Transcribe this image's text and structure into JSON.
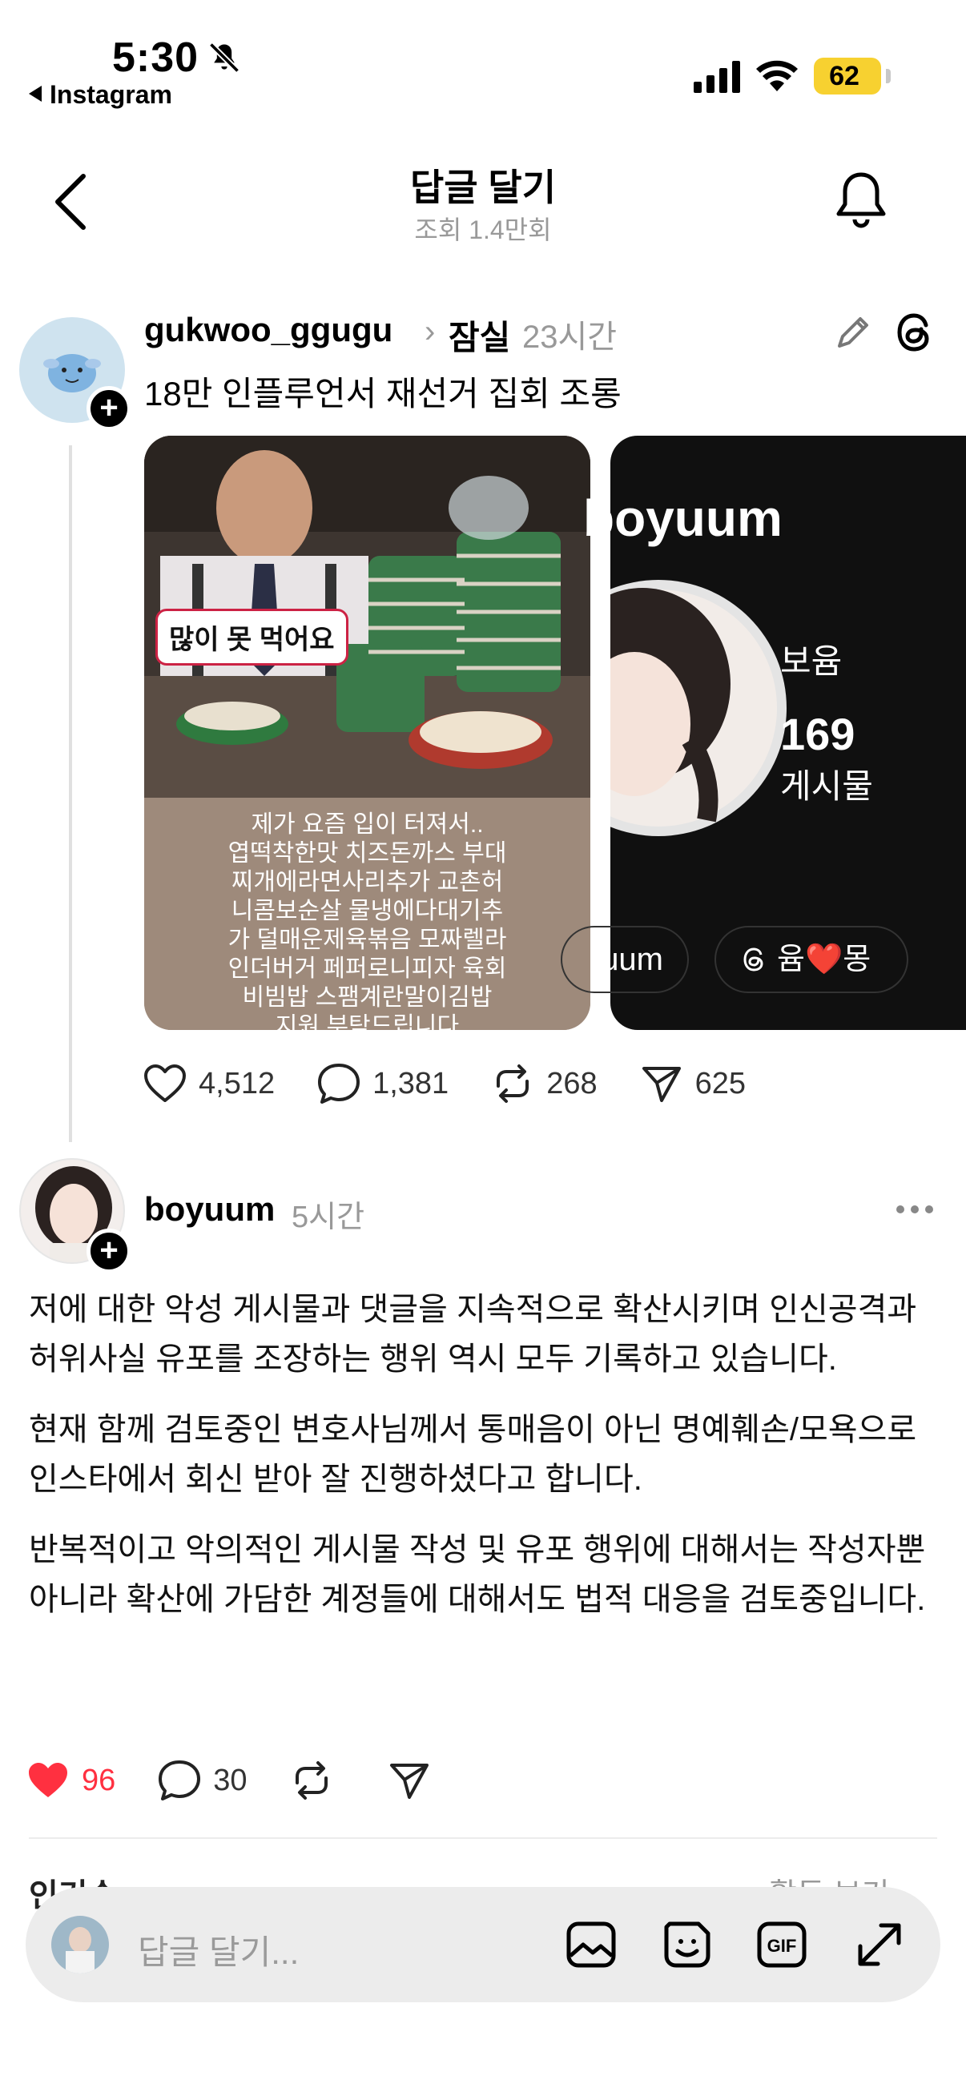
{
  "status_bar": {
    "time": "5:30",
    "back_app": "Instagram",
    "battery": "62"
  },
  "header": {
    "title": "답글 달기",
    "subtitle": "조회 1.4만회"
  },
  "post1": {
    "username": "gukwoo_ggugu",
    "topic": "잠실",
    "time": "23시간",
    "text": "18만 인플루언서 재선거 집회 조롱",
    "image1": {
      "sticker": "많이 못 먹어요",
      "caption": [
        "제가 요즘 입이 터져서..",
        "엽떡착한맛 치즈돈까스 부대",
        "찌개에라면사리추가 교촌허",
        "니콤보순살 물냉에다대기추",
        "가 덜매운제육볶음 모짜렐라",
        "인더버거 페퍼로니피자 육회",
        "비빔밥 스팸계란말이김밥",
        "지원 부탁드립니다"
      ]
    },
    "image2": {
      "handle": "boyuum",
      "name": "보윰",
      "count": "169",
      "count_label": "게시물",
      "button1": "uum",
      "button2": "윰❤️몽"
    },
    "likes": "4,512",
    "comments": "1,381",
    "reposts": "268",
    "shares": "625"
  },
  "post2": {
    "username": "boyuum",
    "time": "5시간",
    "paragraphs": [
      "저에 대한 악성 게시물과 댓글을 지속적으로 확산시키며 인신공격과 허위사실 유포를 조장하는 행위 역시 모두 기록하고 있습니다.",
      "현재 함께 검토중인 변호사님께서 통매음이 아닌 명예훼손/모욕으로 인스타에서 회신 받아 잘 진행하셨다고 합니다.",
      "반복적이고 악의적인 게시물 작성 및 유포 행위에 대해서는 작성자뿐 아니라 확산에 가담한 계정들에 대해서도 법적 대응을 검토중입니다."
    ],
    "likes": "96",
    "comments": "30",
    "like_color": "#ff3040"
  },
  "section": {
    "popular": "인기순",
    "view_all": "활동 보기"
  },
  "composer": {
    "placeholder": "답글 달기..."
  }
}
